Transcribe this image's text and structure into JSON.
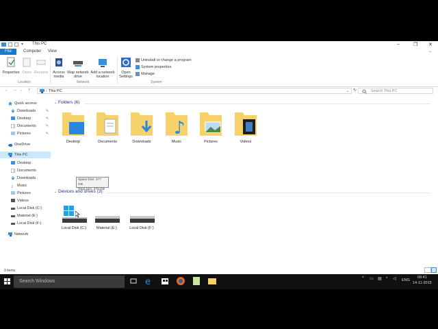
{
  "window": {
    "title": "This PC"
  },
  "ribbon": {
    "tabs": [
      "File",
      "Computer",
      "View"
    ],
    "buttons": {
      "properties": "Properties",
      "open": "Open",
      "rename": "Rename",
      "access_media": "Access media",
      "map_network": "Map network drive",
      "add_network": "Add a network location",
      "open_settings": "Open Settings"
    },
    "small": {
      "uninstall": "Uninstall or change a program",
      "system_properties": "System properties",
      "manage": "Manage"
    },
    "groups": {
      "location": "Location",
      "network": "Network",
      "system": "System"
    }
  },
  "address": {
    "path": "This PC",
    "search_placeholder": "Search This PC"
  },
  "nav": {
    "quick_access": "Quick access",
    "quick_items": [
      "Downloads",
      "Desktop",
      "Documents",
      "Pictures"
    ],
    "onedrive": "OneDrive",
    "this_pc": "This PC",
    "pc_items": [
      "Desktop",
      "Documents",
      "Downloads",
      "Music",
      "Pictures",
      "Videos",
      "Local Disk (C:)",
      "Material (E:)",
      "Local Disk (F:)"
    ],
    "network": "Network"
  },
  "content": {
    "folders_header": "Folders (6)",
    "folders": [
      "Desktop",
      "Documents",
      "Downloads",
      "Music",
      "Pictures",
      "Videos"
    ],
    "drives_header": "Devices and drives (3)",
    "drives": [
      "Local Disk (C:)",
      "Material (E:)",
      "Local Disk (F:)"
    ],
    "tooltip_free": "Space free: 277 GB",
    "tooltip_total": "Total size: 370 GB"
  },
  "status": {
    "items": "9 items"
  },
  "taskbar": {
    "search_placeholder": "Search Windows",
    "language": "ENG",
    "time": "09:41",
    "date": "14-11-2015"
  },
  "colors": {
    "accent": "#1979ca",
    "folder": "#f7d26a",
    "selection": "#cce8ff",
    "header": "#1e3287"
  }
}
